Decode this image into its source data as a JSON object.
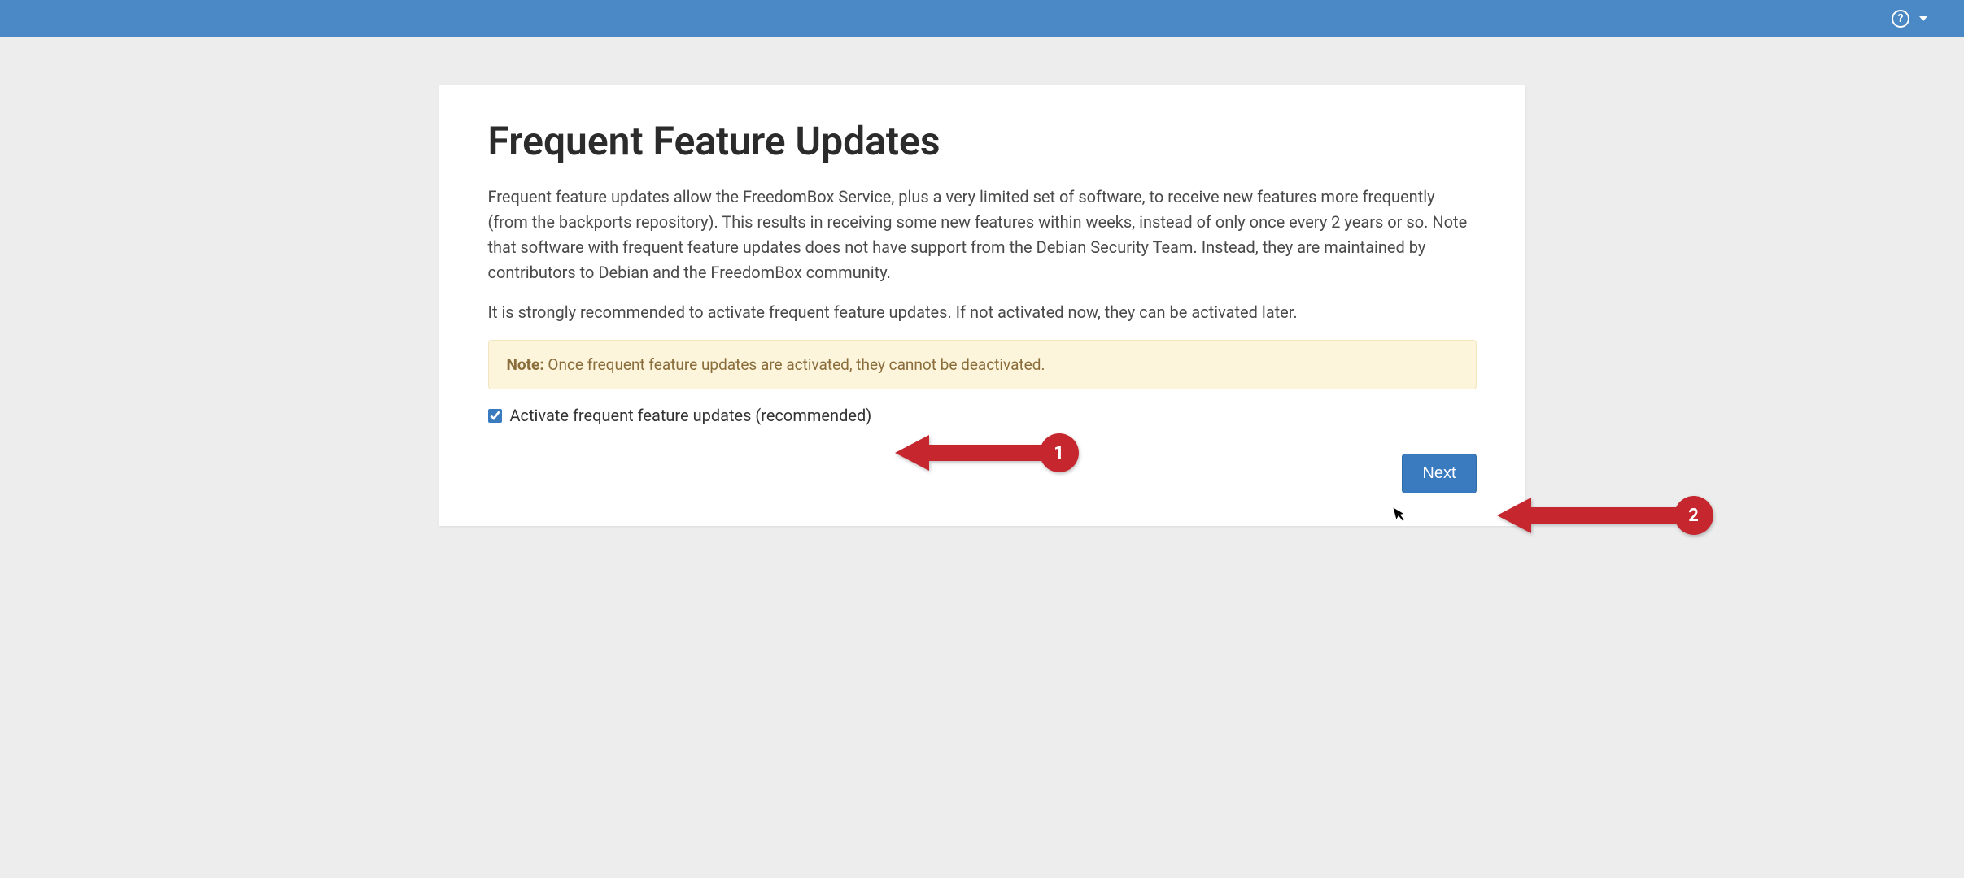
{
  "header": {
    "help_glyph": "?"
  },
  "page": {
    "title": "Frequent Feature Updates",
    "paragraph1": "Frequent feature updates allow the FreedomBox Service, plus a very limited set of software, to receive new features more frequently (from the backports repository). This results in receiving some new features within weeks, instead of only once every 2 years or so. Note that software with frequent feature updates does not have support from the Debian Security Team. Instead, they are maintained by contributors to Debian and the FreedomBox community.",
    "paragraph2": "It is strongly recommended to activate frequent feature updates. If not activated now, they can be activated later.",
    "note_label": "Note:",
    "note_text": " Once frequent feature updates are activated, they cannot be deactivated.",
    "checkbox_label": "Activate frequent feature updates (recommended)",
    "checkbox_checked": true,
    "next_button": "Next"
  },
  "annotations": {
    "marker1": "1",
    "marker2": "2"
  }
}
